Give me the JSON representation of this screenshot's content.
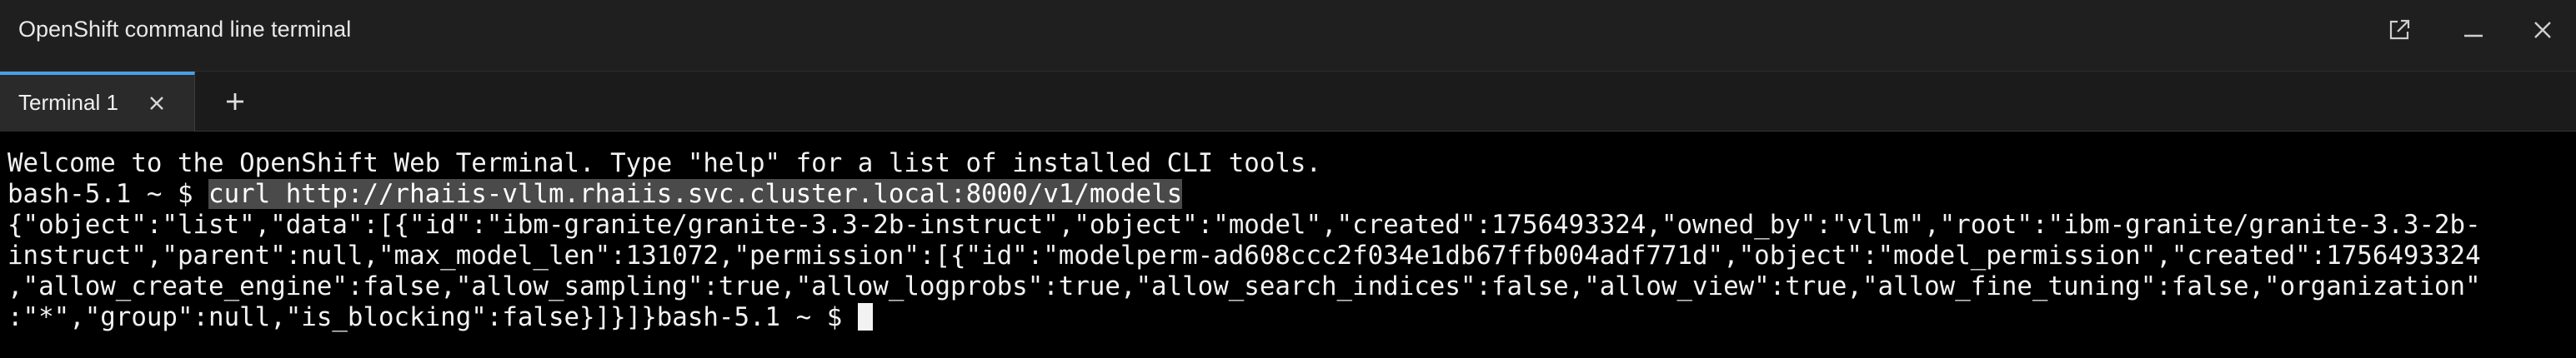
{
  "window": {
    "title": "OpenShift command line terminal"
  },
  "tabs": [
    {
      "label": "Terminal 1",
      "active": true
    }
  ],
  "colors": {
    "active_tab_indicator": "#4a9fe6",
    "terminal_background": "#000000",
    "terminal_text": "#f2f2f2",
    "selection_background": "#4a4a4a"
  },
  "icons": {
    "popout": "external-link-icon",
    "minimize": "minimize-icon",
    "close": "close-icon",
    "tab_close": "close-icon",
    "new_tab": "plus-icon"
  },
  "terminal": {
    "welcome": "Welcome to the OpenShift Web Terminal. Type \"help\" for a list of installed CLI tools.",
    "prompt_1": "bash-5.1 ~ $ ",
    "command_1": "curl http://rhaiis-vllm.rhaiis.svc.cluster.local:8000/v1/models",
    "output": [
      "{\"object\":\"list\",\"data\":[{\"id\":\"ibm-granite/granite-3.3-2b-instruct\",\"object\":\"model\",\"created\":1756493324,\"owned_by\":\"vllm\",\"root\":\"ibm-granite/granite-3.3-2b-",
      "instruct\",\"parent\":null,\"max_model_len\":131072,\"permission\":[{\"id\":\"modelperm-ad608ccc2f034e1db67ffb004adf771d\",\"object\":\"model_permission\",\"created\":1756493324",
      ",\"allow_create_engine\":false,\"allow_sampling\":true,\"allow_logprobs\":true,\"allow_search_indices\":false,\"allow_view\":true,\"allow_fine_tuning\":false,\"organization\""
    ],
    "last_output": ":\"*\",\"group\":null,\"is_blocking\":false}]}]}",
    "prompt_2": "bash-5.1 ~ $ "
  }
}
